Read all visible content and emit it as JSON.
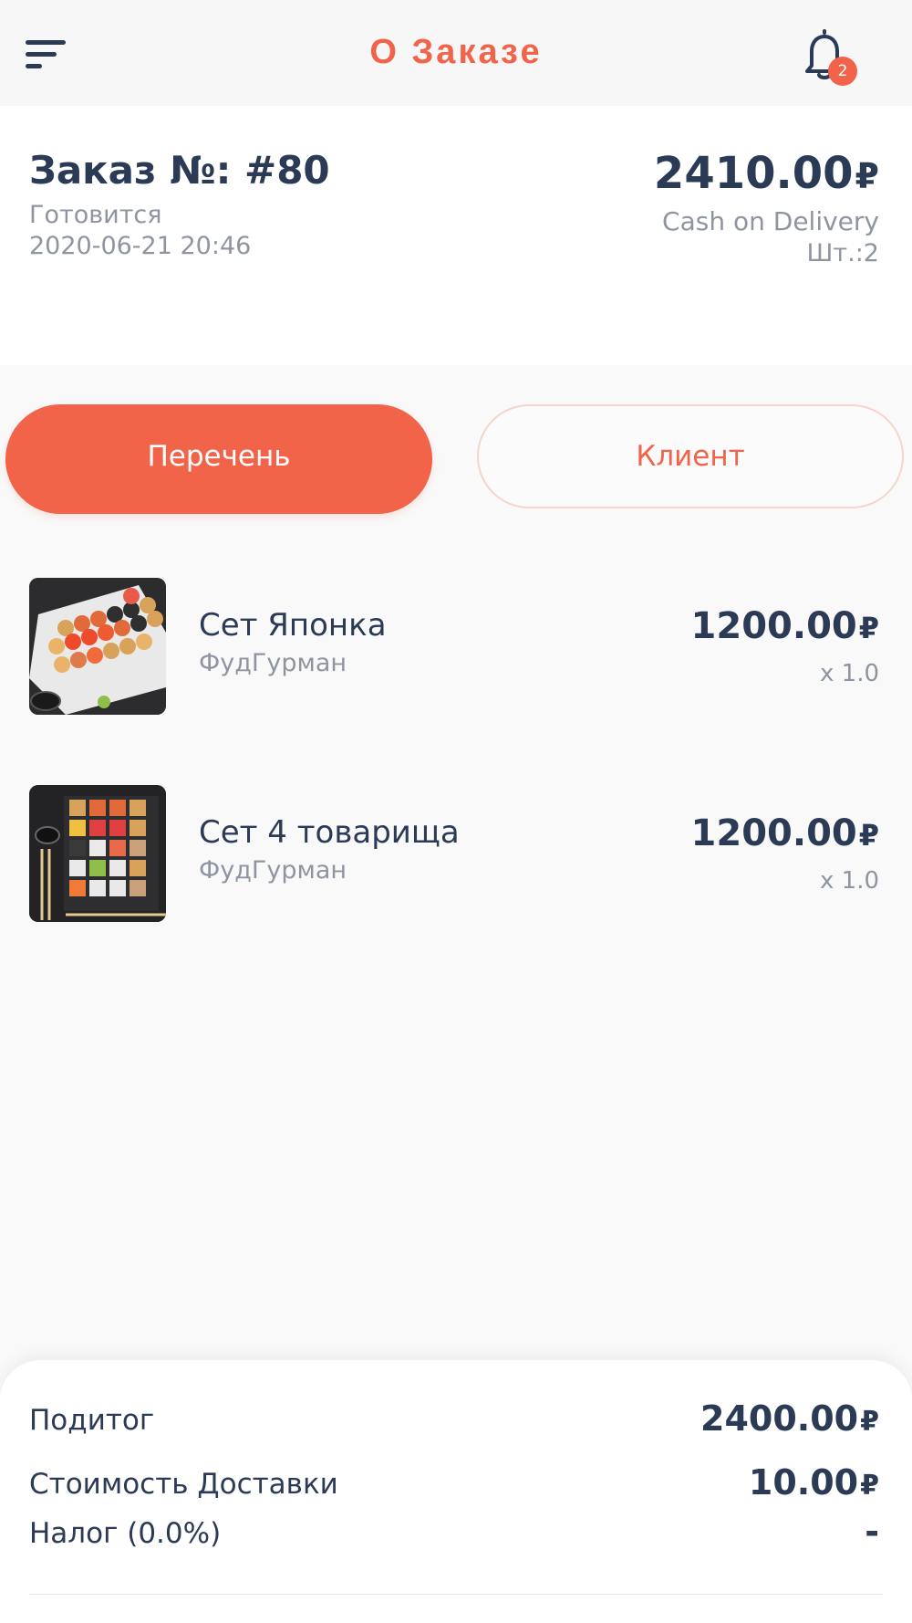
{
  "header": {
    "title": "О Заказе",
    "notification_count": "2",
    "accent_color": "#f2644a"
  },
  "order": {
    "number": "Заказ №: #80",
    "status": "Готовится",
    "datetime": "2020-06-21 20:46",
    "total": "2410.00",
    "currency": "₽",
    "payment_method": "Cash on Delivery",
    "quantity": "Шт.:2"
  },
  "tabs": [
    {
      "label": "Перечень",
      "active": true
    },
    {
      "label": "Клиент",
      "active": false
    }
  ],
  "items": [
    {
      "name": "Сет Японка",
      "vendor": "ФудГурман",
      "price": "1200.00",
      "currency": "₽",
      "qty": "x 1.0",
      "image": "sushi-set-plate-photo"
    },
    {
      "name": "Сет 4 товарища",
      "vendor": "ФудГурман",
      "price": "1200.00",
      "currency": "₽",
      "qty": "x 1.0",
      "image": "sushi-set-board-photo"
    }
  ],
  "summary": {
    "subtotal_label": "Подитог",
    "subtotal_value": "2400.00",
    "delivery_label": "Стоимость Доставки",
    "delivery_value": "10.00",
    "tax_label": "Налог (0.0%)",
    "tax_value": "-",
    "currency": "₽"
  }
}
